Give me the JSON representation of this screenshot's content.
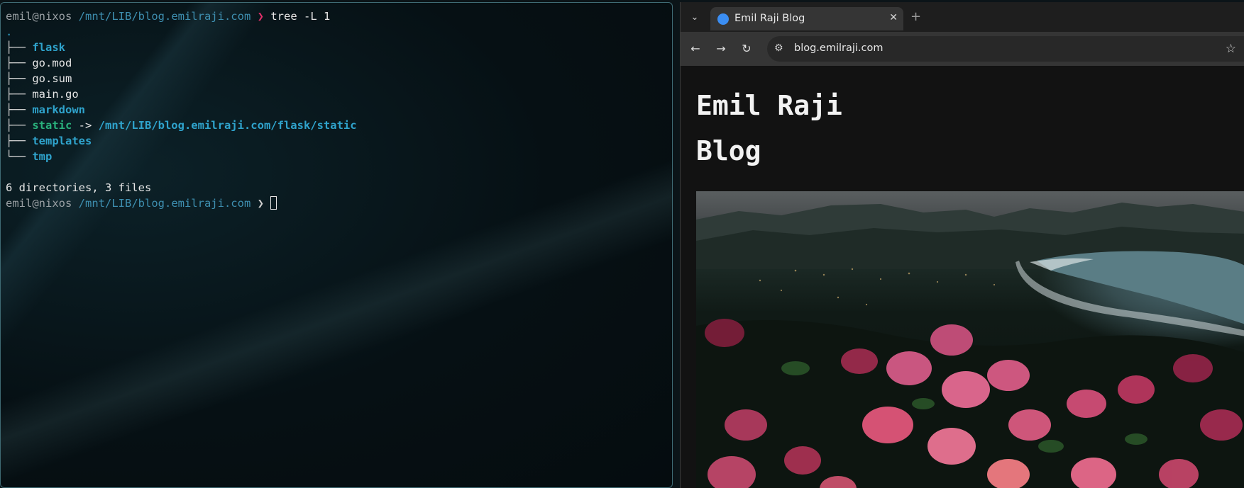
{
  "terminal": {
    "user_host": "emil@nixos",
    "cwd": "/mnt/LIB/blog.emilraji.com",
    "prompt_char": "❯",
    "command": "tree -L 1",
    "root": ".",
    "entries": [
      {
        "branch": "├── ",
        "name": "flask",
        "kind": "dir"
      },
      {
        "branch": "├── ",
        "name": "go.mod",
        "kind": "file"
      },
      {
        "branch": "├── ",
        "name": "go.sum",
        "kind": "file"
      },
      {
        "branch": "├── ",
        "name": "main.go",
        "kind": "file"
      },
      {
        "branch": "├── ",
        "name": "markdown",
        "kind": "dir"
      },
      {
        "branch": "├── ",
        "name": "static",
        "kind": "link",
        "arrow": " -> ",
        "target": "/mnt/LIB/blog.emilraji.com/flask/static"
      },
      {
        "branch": "├── ",
        "name": "templates",
        "kind": "dir"
      },
      {
        "branch": "└── ",
        "name": "tmp",
        "kind": "dir"
      }
    ],
    "summary": "6 directories, 3 files"
  },
  "browser": {
    "tab_title": "Emil Raji Blog",
    "tab_close": "✕",
    "new_tab": "+",
    "tab_list_icon": "⌄",
    "back_icon": "←",
    "forward_icon": "→",
    "reload_icon": "↻",
    "site_info_icon": "⚙",
    "url": "blog.emilraji.com",
    "bookmark_icon": "☆",
    "page": {
      "title_line1": "Emil Raji",
      "title_line2": "Blog"
    }
  }
}
